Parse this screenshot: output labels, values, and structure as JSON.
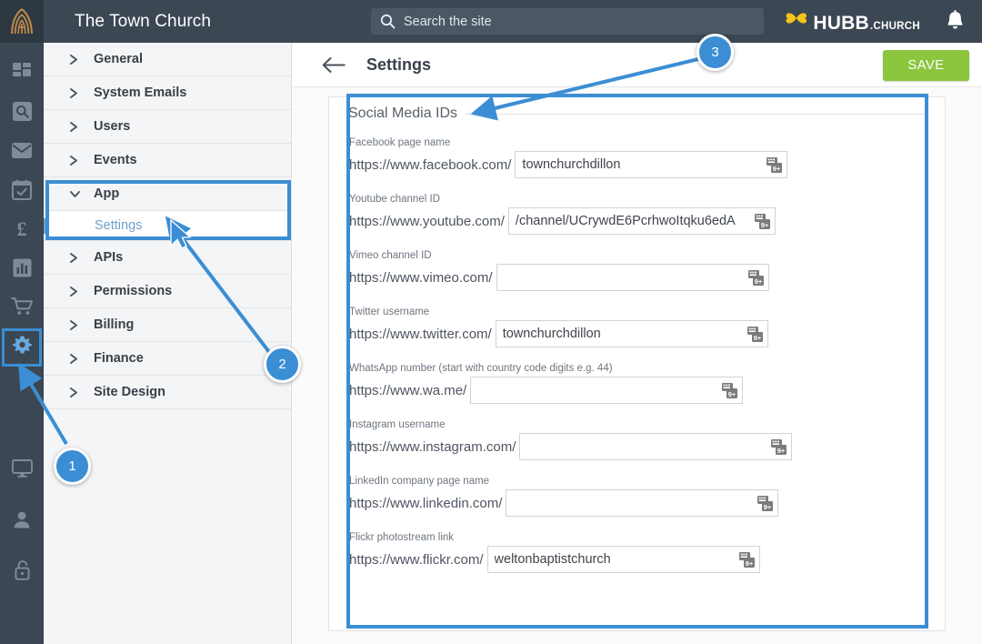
{
  "topbar": {
    "site_title": "The Town Church",
    "logo_icon": "church-arch-cross-icon",
    "search": {
      "placeholder": "Search the site",
      "value": "",
      "icon": "search-icon"
    },
    "product_logo": {
      "mark_icon": "hubb-butterfly-icon",
      "word": "HUBB",
      "tld": ".CHURCH",
      "mark_color": "#f5c518"
    },
    "notifications_icon": "bell-icon",
    "background_color": "#3b4753"
  },
  "rail": {
    "items": [
      {
        "icon": "dashboard-grid-icon",
        "active": false
      },
      {
        "icon": "search-square-icon",
        "active": false
      },
      {
        "icon": "mail-envelope-icon",
        "active": false
      },
      {
        "icon": "calendar-check-icon",
        "active": false
      },
      {
        "icon": "pound-currency-icon",
        "active": false
      },
      {
        "icon": "bar-chart-icon",
        "active": false
      },
      {
        "icon": "shopping-cart-icon",
        "active": false
      },
      {
        "icon": "gear-settings-icon",
        "active": true
      }
    ],
    "bottom_items": [
      {
        "icon": "monitor-display-icon",
        "active": false
      },
      {
        "icon": "user-person-icon",
        "active": false
      },
      {
        "icon": "padlock-unlocked-icon",
        "active": false
      }
    ],
    "active_outline_color": "#3b8ed4"
  },
  "sidebar": {
    "items": [
      {
        "label": "General",
        "caret": "chevron-right-icon",
        "expanded": false
      },
      {
        "label": "System Emails",
        "caret": "chevron-right-icon",
        "expanded": false
      },
      {
        "label": "Users",
        "caret": "chevron-right-icon",
        "expanded": false
      },
      {
        "label": "Events",
        "caret": "chevron-right-icon",
        "expanded": false
      },
      {
        "label": "App",
        "caret": "chevron-down-icon",
        "expanded": true
      },
      {
        "label": "APIs",
        "caret": "chevron-right-icon",
        "expanded": false
      },
      {
        "label": "Permissions",
        "caret": "chevron-right-icon",
        "expanded": false
      },
      {
        "label": "Billing",
        "caret": "chevron-right-icon",
        "expanded": false
      },
      {
        "label": "Finance",
        "caret": "chevron-right-icon",
        "expanded": false
      },
      {
        "label": "Site Design",
        "caret": "chevron-right-icon",
        "expanded": false
      }
    ],
    "sub_item": {
      "label": "Settings",
      "parent": "App",
      "selected": true
    }
  },
  "page": {
    "back_icon": "arrow-left-icon",
    "title": "Settings",
    "save_label": "SAVE",
    "save_color": "#8cc63e"
  },
  "form": {
    "legend": "Social Media IDs",
    "fields": [
      {
        "label": "Facebook page name",
        "prefix": "https://www.facebook.com/",
        "value": "townchurchdillon",
        "placeholder": "",
        "input_width": 300,
        "icon": "keyboard-input-icon"
      },
      {
        "label": "Youtube channel ID",
        "prefix": "https://www.youtube.com/",
        "value": "/channel/UCrywdE6PcrhwoItqku6edA",
        "placeholder": "",
        "input_width": 294,
        "icon": "keyboard-input-icon"
      },
      {
        "label": "Vimeo channel ID",
        "prefix": "https://www.vimeo.com/",
        "value": "",
        "placeholder": "",
        "input_width": 300,
        "icon": "keyboard-input-icon"
      },
      {
        "label": "Twitter username",
        "prefix": "https://www.twitter.com/",
        "value": "townchurchdillon",
        "placeholder": "",
        "input_width": 300,
        "icon": "keyboard-input-icon"
      },
      {
        "label": "WhatsApp number (start with country code digits e.g. 44)",
        "prefix": "https://www.wa.me/",
        "value": "",
        "placeholder": "",
        "input_width": 300,
        "icon": "keyboard-input-icon"
      },
      {
        "label": "Instagram username",
        "prefix": "https://www.instagram.com/",
        "value": "",
        "placeholder": "",
        "input_width": 300,
        "icon": "keyboard-input-icon"
      },
      {
        "label": "LinkedIn company page name",
        "prefix": "https://www.linkedin.com/",
        "value": "",
        "placeholder": "",
        "input_width": 300,
        "icon": "keyboard-input-icon"
      },
      {
        "label": "Flickr photostream link",
        "prefix": "https://www.flickr.com/",
        "value": "weltonbaptistchurch",
        "placeholder": "",
        "input_width": 300,
        "icon": "keyboard-input-icon"
      }
    ]
  },
  "annotations": {
    "accent_color": "#3b8ed4",
    "markers": [
      {
        "number": "1",
        "target": "gear-settings-icon"
      },
      {
        "number": "2",
        "target": "sidebar-sub-item-settings"
      },
      {
        "number": "3",
        "target": "social-media-ids-card"
      }
    ],
    "cursor": "mouse-pointer"
  }
}
